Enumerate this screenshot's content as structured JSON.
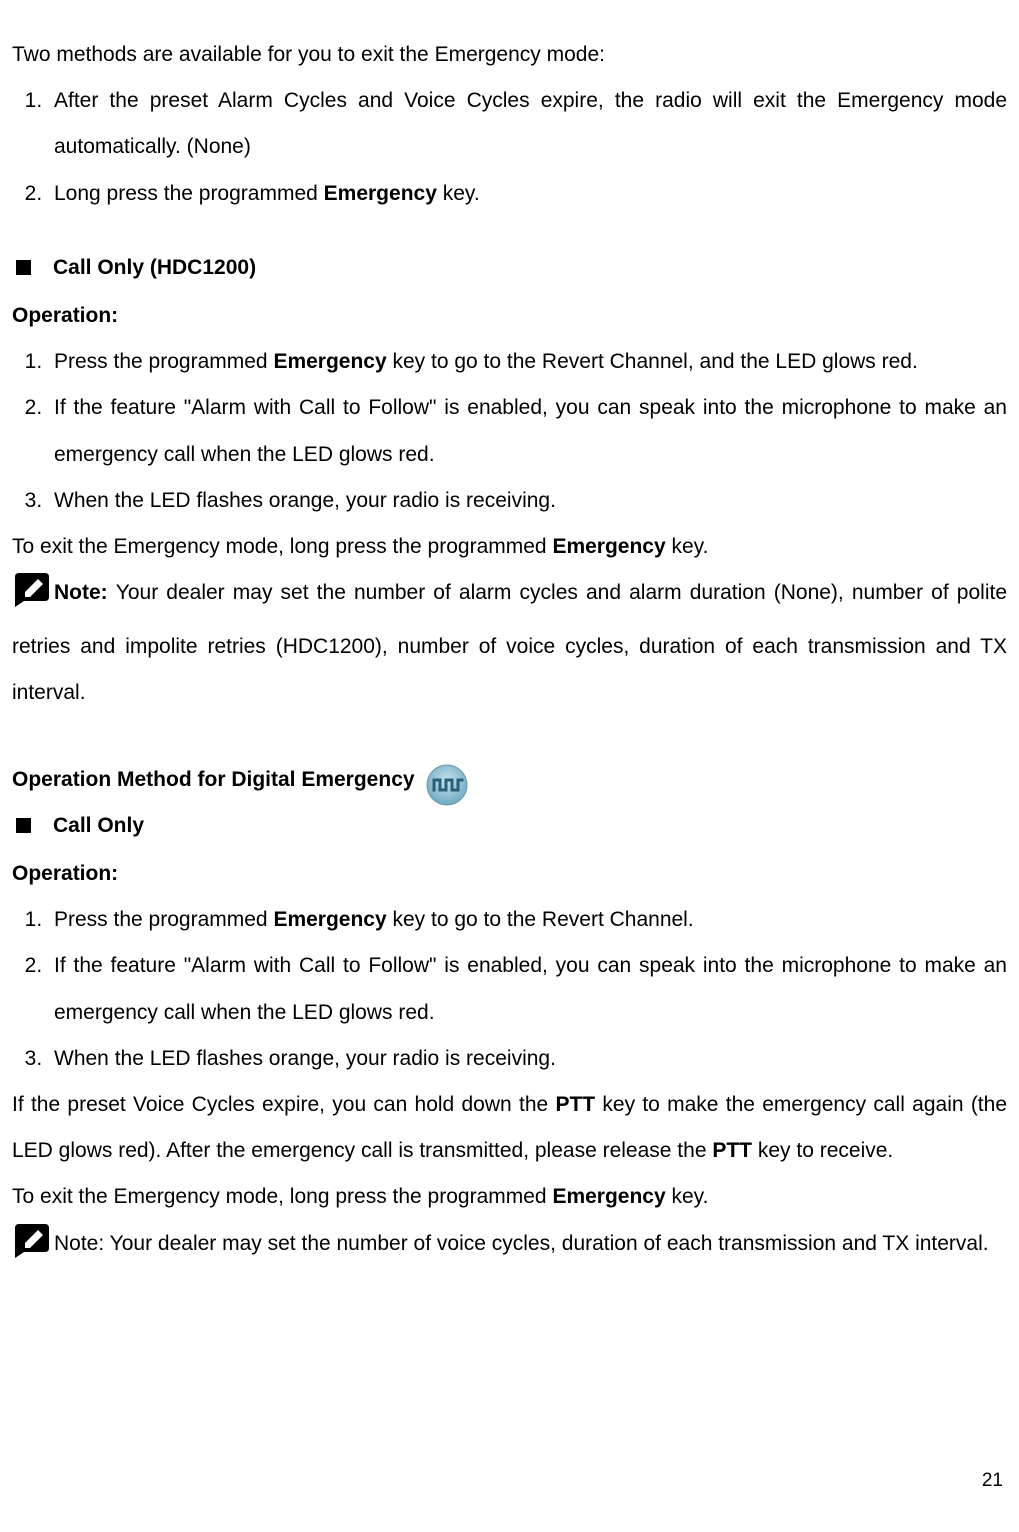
{
  "intro": "Two methods are available for you to exit the Emergency mode:",
  "exit_methods": [
    {
      "pre": "After the preset Alarm Cycles and Voice Cycles expire, the radio will exit the Emergency mode automatically. (None)"
    },
    {
      "pre": "Long press the programmed ",
      "b1": "Emergency",
      "post": " key."
    }
  ],
  "s1": {
    "title": "Call Only (HDC1200)",
    "op_label": "Operation:",
    "items": [
      {
        "pre": "Press the programmed ",
        "b1": "Emergency",
        "post": " key to go to the Revert Channel, and the LED glows red."
      },
      {
        "pre": "If the feature \"Alarm with Call to Follow\" is enabled, you can speak into the microphone to make an emergency call when the LED glows red."
      },
      {
        "pre": "When the LED flashes orange, your radio is receiving."
      }
    ],
    "exit_pre": "To exit the Emergency mode, long press the programmed ",
    "exit_b": "Emergency",
    "exit_post": " key.",
    "note_b": "Note: ",
    "note_txt": "Your dealer may set the number of alarm cycles and alarm duration (None),  number of polite retries and impolite retries (HDC1200), number of voice cycles, duration of each transmission and TX interval."
  },
  "s2": {
    "header": "Operation Method for Digital Emergency",
    "title": "Call Only",
    "op_label": "Operation:",
    "items": [
      {
        "pre": "Press the programmed ",
        "b1": "Emergency",
        "post": " key to go to the Revert Channel."
      },
      {
        "pre": "If the feature \"Alarm with Call to Follow\" is enabled, you can speak into the microphone to make an emergency call when the LED glows red."
      },
      {
        "pre": "When the LED flashes orange, your radio is receiving."
      }
    ],
    "ptt_p1": "If the preset Voice Cycles expire, you can hold down the ",
    "ptt_b1": "PTT",
    "ptt_p2": " key to make the emergency call again (the LED glows red). After the emergency call is transmitted, please release the ",
    "ptt_b2": "PTT",
    "ptt_p3": " key to receive.",
    "exit_pre": "To exit the Emergency mode, long press the programmed ",
    "exit_b": "Emergency",
    "exit_post": " key.",
    "note_txt": "Note: Your dealer may set the number of voice cycles, duration of each transmission and TX interval."
  },
  "page_number": "21"
}
